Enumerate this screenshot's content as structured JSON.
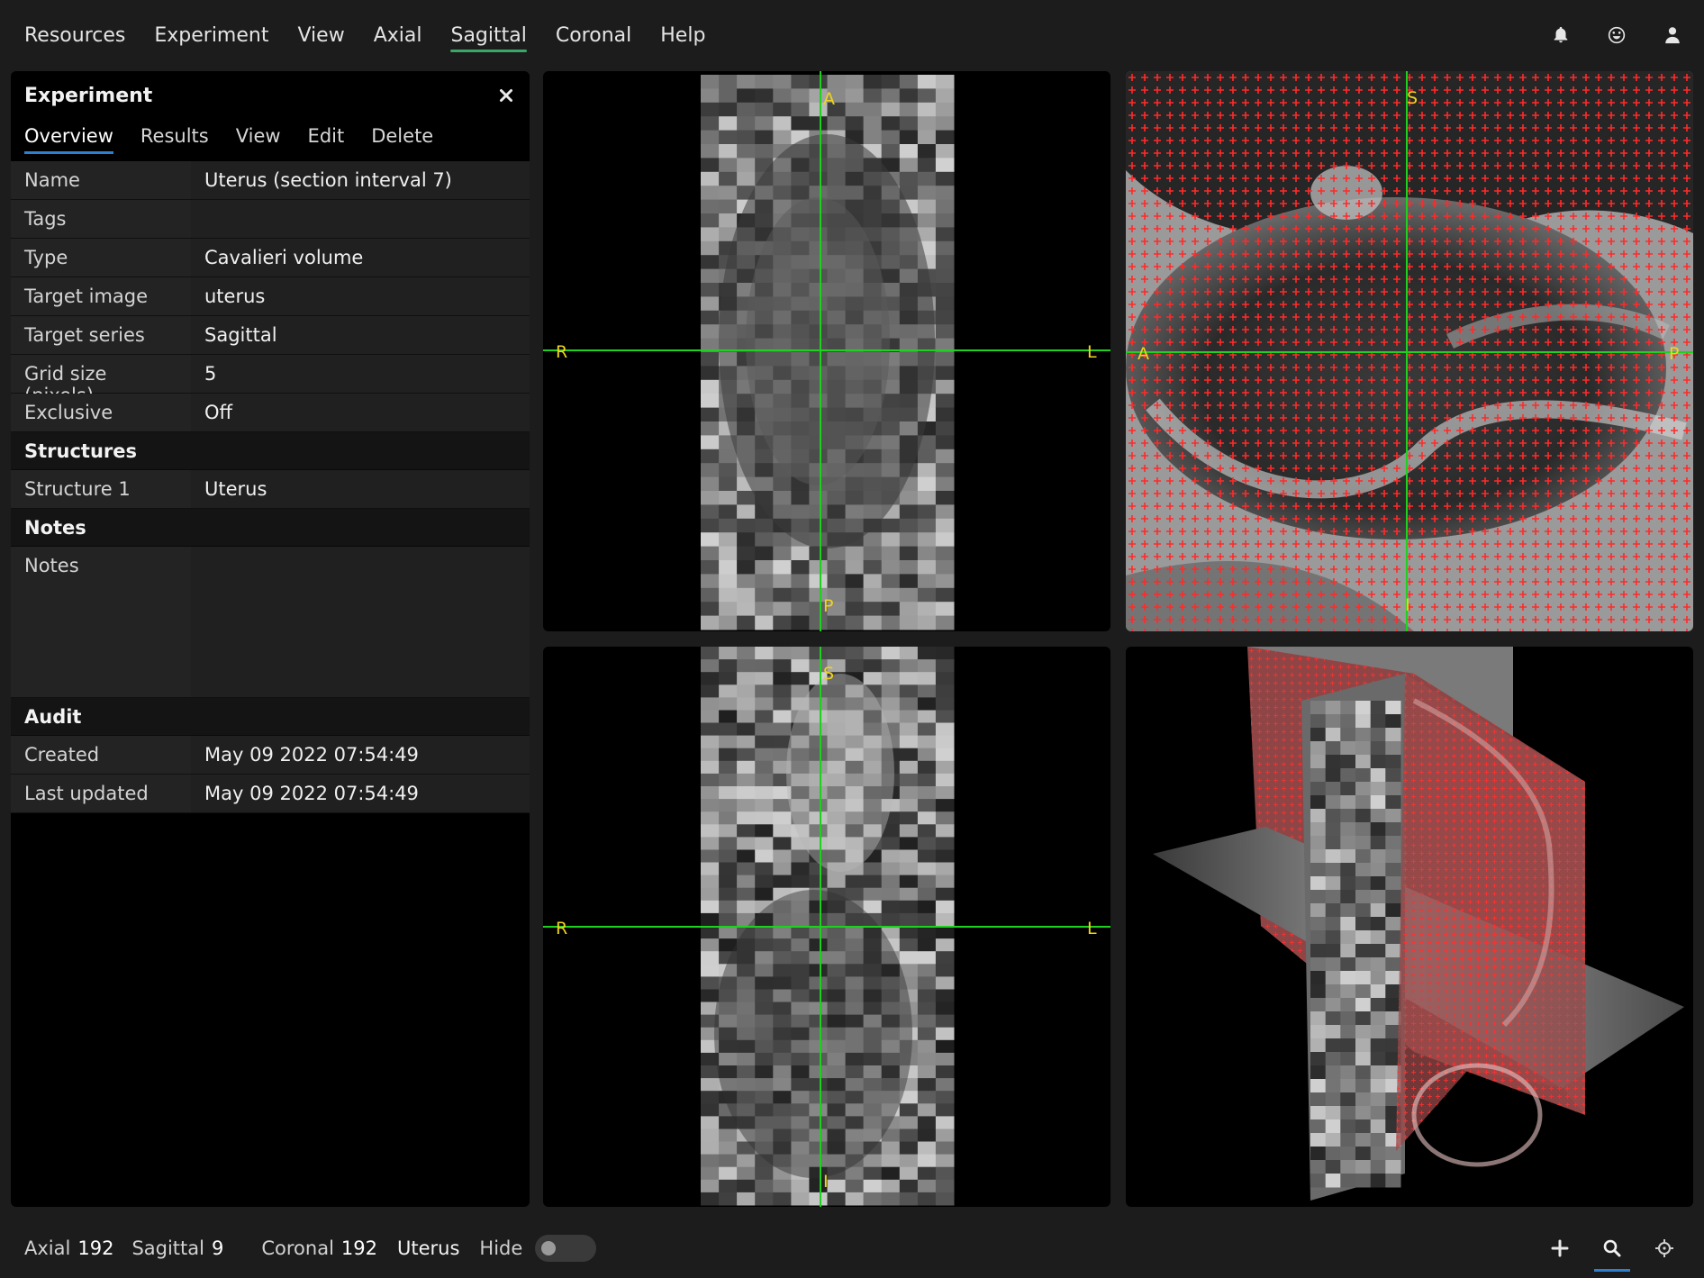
{
  "menu": {
    "items": [
      "Resources",
      "Experiment",
      "View",
      "Axial",
      "Sagittal",
      "Coronal",
      "Help"
    ],
    "active": "Sagittal"
  },
  "top_icons": [
    "bell-icon",
    "smiley-icon",
    "user-icon"
  ],
  "panel": {
    "title": "Experiment",
    "tabs": [
      "Overview",
      "Results",
      "View",
      "Edit",
      "Delete"
    ],
    "active_tab": "Overview",
    "details": [
      {
        "key": "Name",
        "value": "Uterus (section interval 7)"
      },
      {
        "key": "Tags",
        "value": ""
      },
      {
        "key": "Type",
        "value": "Cavalieri volume"
      },
      {
        "key": "Target image",
        "value": "uterus"
      },
      {
        "key": "Target series",
        "value": "Sagittal"
      },
      {
        "key": "Grid size (pixels)",
        "value": "5"
      },
      {
        "key": "Exclusive",
        "value": "Off"
      }
    ],
    "structures_title": "Structures",
    "structures": [
      {
        "key": "Structure 1",
        "value": "Uterus"
      }
    ],
    "notes_title": "Notes",
    "notes": {
      "key": "Notes",
      "value": ""
    },
    "audit_title": "Audit",
    "audit": [
      {
        "key": "Created",
        "value": "May 09 2022 07:54:49"
      },
      {
        "key": "Last updated",
        "value": "May 09 2022 07:54:49"
      }
    ]
  },
  "viewports": {
    "axial": {
      "top": "A",
      "bottom": "P",
      "left": "R",
      "right": "L"
    },
    "sagittal": {
      "top": "S",
      "bottom": "I",
      "left": "A",
      "right": "P"
    },
    "coronal": {
      "top": "S",
      "bottom": "I",
      "left": "R",
      "right": "L"
    }
  },
  "colors": {
    "crosshair": "#1fd11f",
    "orientation_label": "#f1d31e",
    "grid": "#ff2020",
    "tab_accent": "#2d7fd0",
    "menu_accent": "#3aa66a"
  },
  "bottom": {
    "axial_label": "Axial",
    "axial_value": "192",
    "sagittal_label": "Sagittal",
    "sagittal_value": "9",
    "coronal_label": "Coronal",
    "coronal_value": "192",
    "structure": "Uterus",
    "hide_label": "Hide",
    "hide_on": false,
    "tools": [
      "plus-icon",
      "search-icon",
      "crosshair-icon"
    ],
    "active_tool": "search-icon"
  }
}
